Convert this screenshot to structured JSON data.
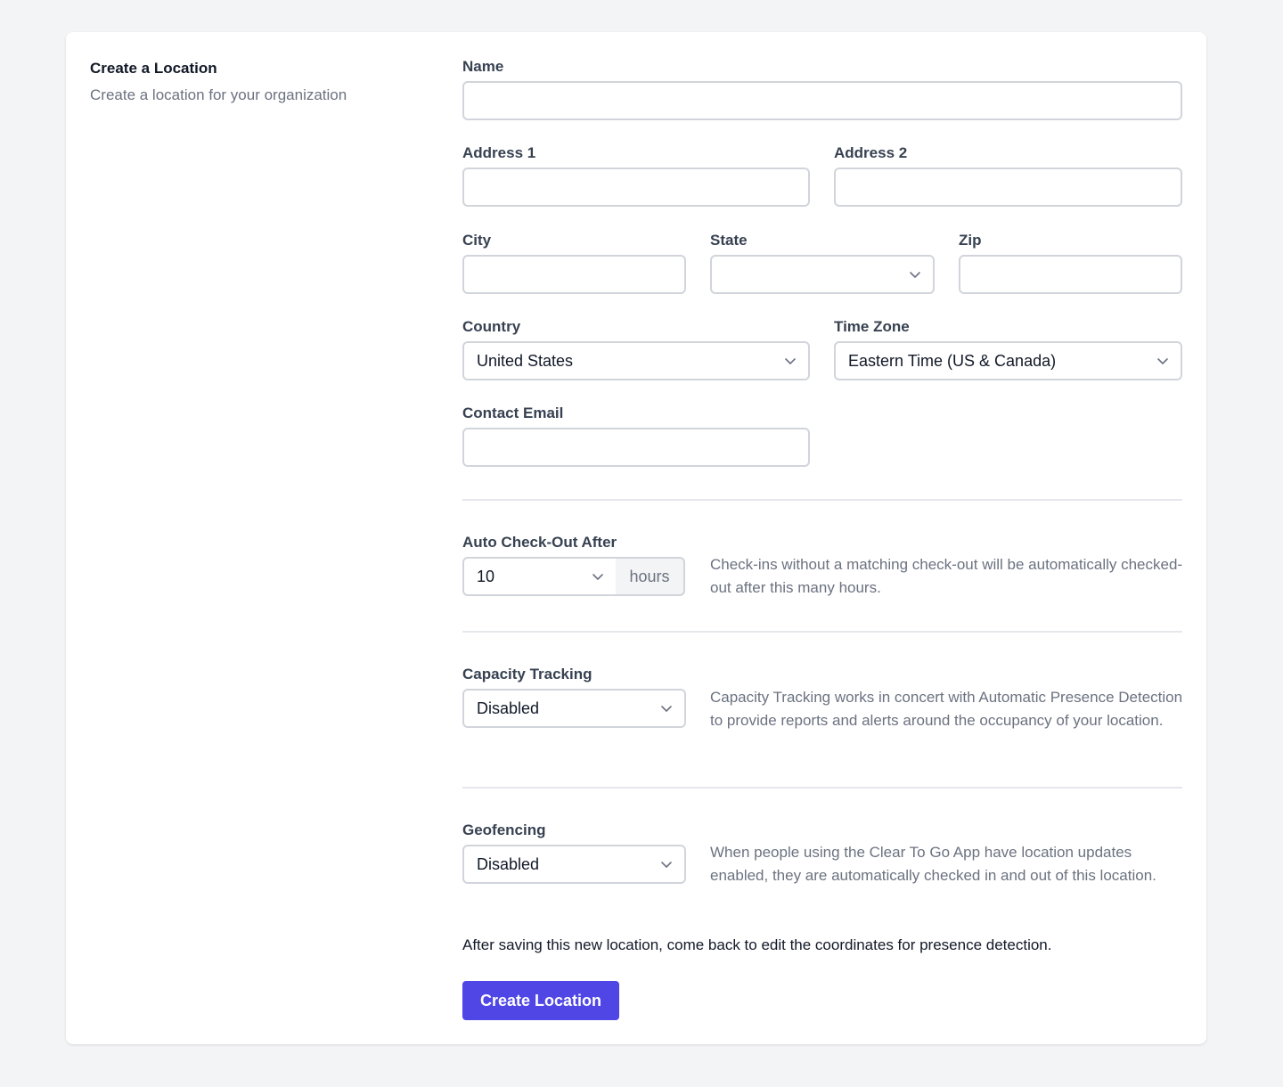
{
  "intro": {
    "title": "Create a Location",
    "subtitle": "Create a location for your organization"
  },
  "fields": {
    "name": {
      "label": "Name",
      "value": ""
    },
    "address1": {
      "label": "Address 1",
      "value": ""
    },
    "address2": {
      "label": "Address 2",
      "value": ""
    },
    "city": {
      "label": "City",
      "value": ""
    },
    "state": {
      "label": "State",
      "value": ""
    },
    "zip": {
      "label": "Zip",
      "value": ""
    },
    "country": {
      "label": "Country",
      "value": "United States"
    },
    "timezone": {
      "label": "Time Zone",
      "value": "Eastern Time (US & Canada)"
    },
    "contact_email": {
      "label": "Contact Email",
      "value": ""
    }
  },
  "auto_checkout": {
    "label": "Auto Check-Out After",
    "value": "10",
    "unit": "hours",
    "help": "Check-ins without a matching check-out will be automatically checked-out after this many hours."
  },
  "capacity_tracking": {
    "label": "Capacity Tracking",
    "value": "Disabled",
    "help": "Capacity Tracking works in concert with Automatic Presence Detection to provide reports and alerts around the occupancy of your location."
  },
  "geofencing": {
    "label": "Geofencing",
    "value": "Disabled",
    "help": "When people using the Clear To Go App have location updates enabled, they are automatically checked in and out of this location."
  },
  "note": "After saving this new location, come back to edit the coordinates for presence detection.",
  "submit_label": "Create Location",
  "colors": {
    "primary": "#4f46e5",
    "background": "#f3f4f6",
    "border": "#d1d5db",
    "muted_text": "#6b7280"
  },
  "icons": {
    "select_arrow": "chevron-down-icon"
  }
}
